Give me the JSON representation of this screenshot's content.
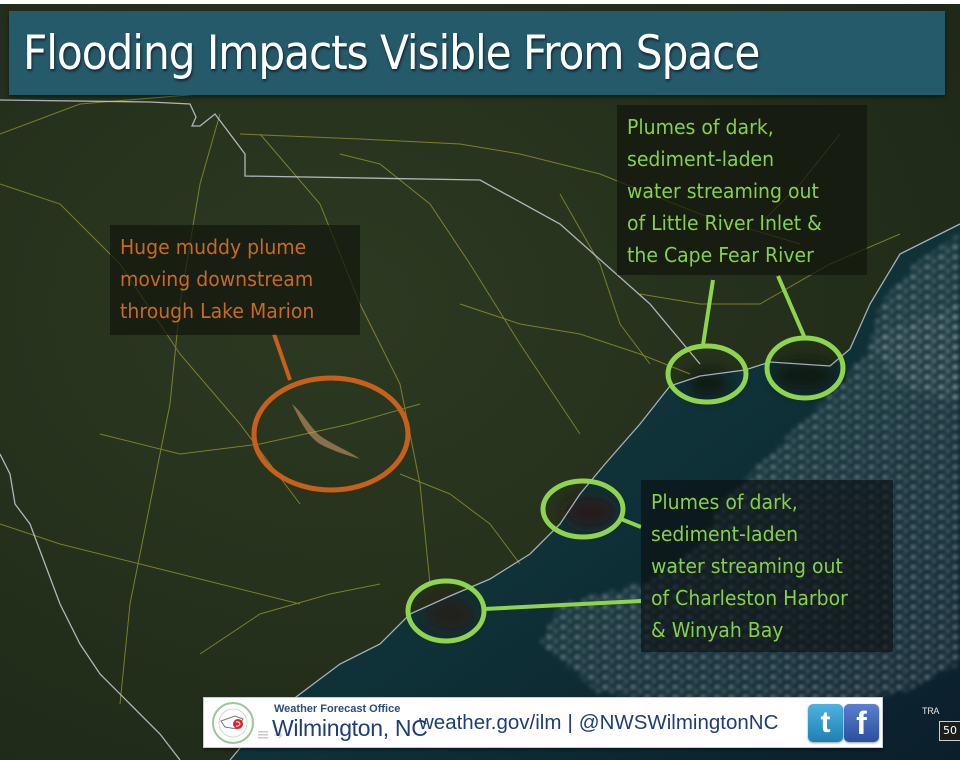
{
  "title": "Flooding Impacts Visible From Space",
  "annotations": {
    "lake_marion": {
      "lines": [
        "Huge muddy plume",
        "moving downstream",
        "through Lake Marion"
      ],
      "color": "#c96a22"
    },
    "little_river_cape_fear": {
      "lines": [
        "Plumes of dark,",
        "sediment-laden",
        "water streaming out",
        "of Little River Inlet &",
        "the Cape Fear River"
      ],
      "color": "#86d04a"
    },
    "charleston_winyah": {
      "lines": [
        "Plumes of dark,",
        "sediment-laden",
        "water streaming out",
        "of Charleston Harbor",
        "& Winyah Bay"
      ],
      "color": "#86d04a"
    }
  },
  "footer": {
    "logo_icon": "nws-logo-icon",
    "office_label": "Weather Forecast Office",
    "office_city": "Wilmington, NC",
    "website": "weather.gov/ilm",
    "separator": "|",
    "twitter_handle": "@NWSWilmingtonNC",
    "twitter_icon_glyph": "t",
    "facebook_icon_glyph": "f"
  },
  "corner": {
    "tra_label": "TRA",
    "scale_value": "50"
  },
  "colors": {
    "title_bg": "#255a6a",
    "land": "#26321c",
    "ocean": "#123a3e",
    "roads": "#b6b13a",
    "borders": "#c8ccd6"
  }
}
